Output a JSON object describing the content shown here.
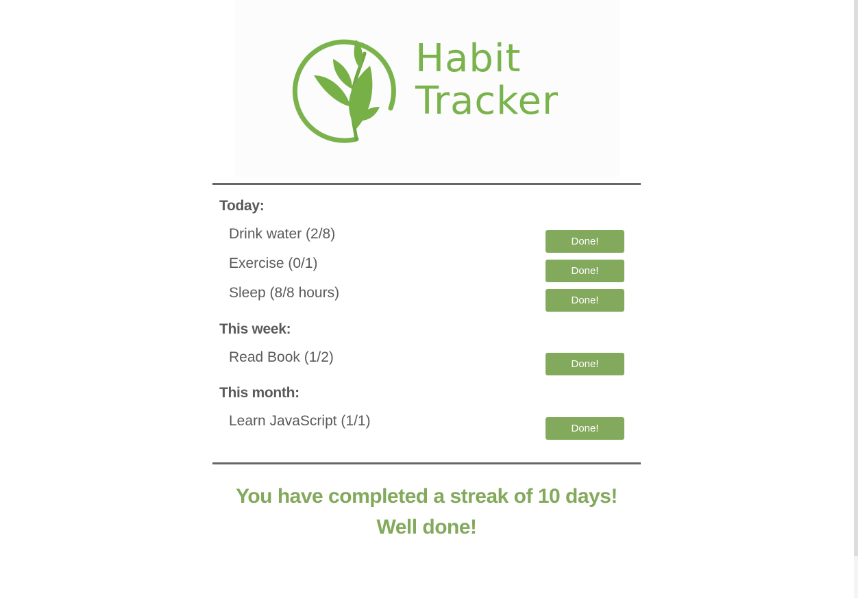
{
  "logo": {
    "line1": "Habit",
    "line2": "Tracker",
    "brand_color": "#7ab24b",
    "icon": "leaf-circle-icon"
  },
  "sections": [
    {
      "heading": "Today:",
      "habits": [
        {
          "label": "Drink water (2/8)",
          "button": "Done!"
        },
        {
          "label": "Exercise (0/1)",
          "button": "Done!"
        },
        {
          "label": "Sleep (8/8 hours)",
          "button": "Done!"
        }
      ]
    },
    {
      "heading": "This week:",
      "habits": [
        {
          "label": "Read Book (1/2)",
          "button": "Done!"
        }
      ]
    },
    {
      "heading": "This month:",
      "habits": [
        {
          "label": "Learn JavaScript (1/1)",
          "button": "Done!"
        }
      ]
    }
  ],
  "streak": {
    "line1": "You have completed a streak of 10 days!",
    "line2": "Well done!"
  },
  "colors": {
    "button": "#82a95c",
    "divider": "#666666",
    "text": "#5a5a5a"
  }
}
